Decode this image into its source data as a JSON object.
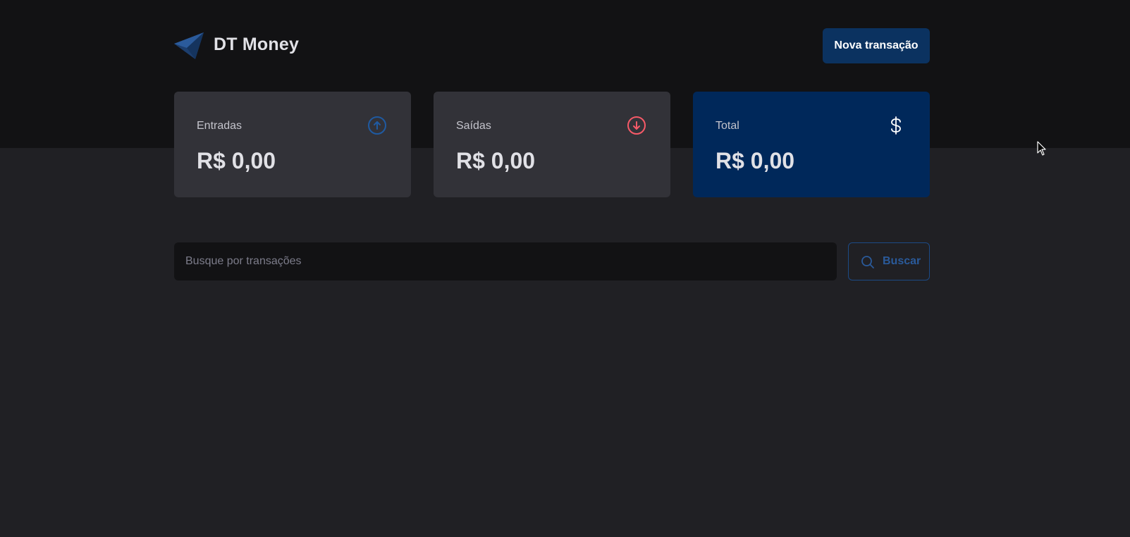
{
  "app": {
    "name": "DT Money"
  },
  "header": {
    "new_transaction_label": "Nova transação"
  },
  "summary": [
    {
      "title": "Entradas",
      "value": "R$ 0,00",
      "icon": "arrow-circle-up-icon",
      "icon_color": "#1f5aa1"
    },
    {
      "title": "Saídas",
      "value": "R$ 0,00",
      "icon": "arrow-circle-down-icon",
      "icon_color": "#f75a68"
    },
    {
      "title": "Total",
      "value": "R$ 0,00",
      "icon": "currency-dollar-icon",
      "icon_color": "#ffffff"
    }
  ],
  "search": {
    "placeholder": "Busque por transações",
    "value": "",
    "button_label": "Buscar",
    "icon": "search-icon"
  },
  "colors": {
    "header_bg": "#121214",
    "page_bg": "#202024",
    "card_bg": "#323238",
    "total_card_bg": "#00285a",
    "primary_button": "#0b3260"
  }
}
